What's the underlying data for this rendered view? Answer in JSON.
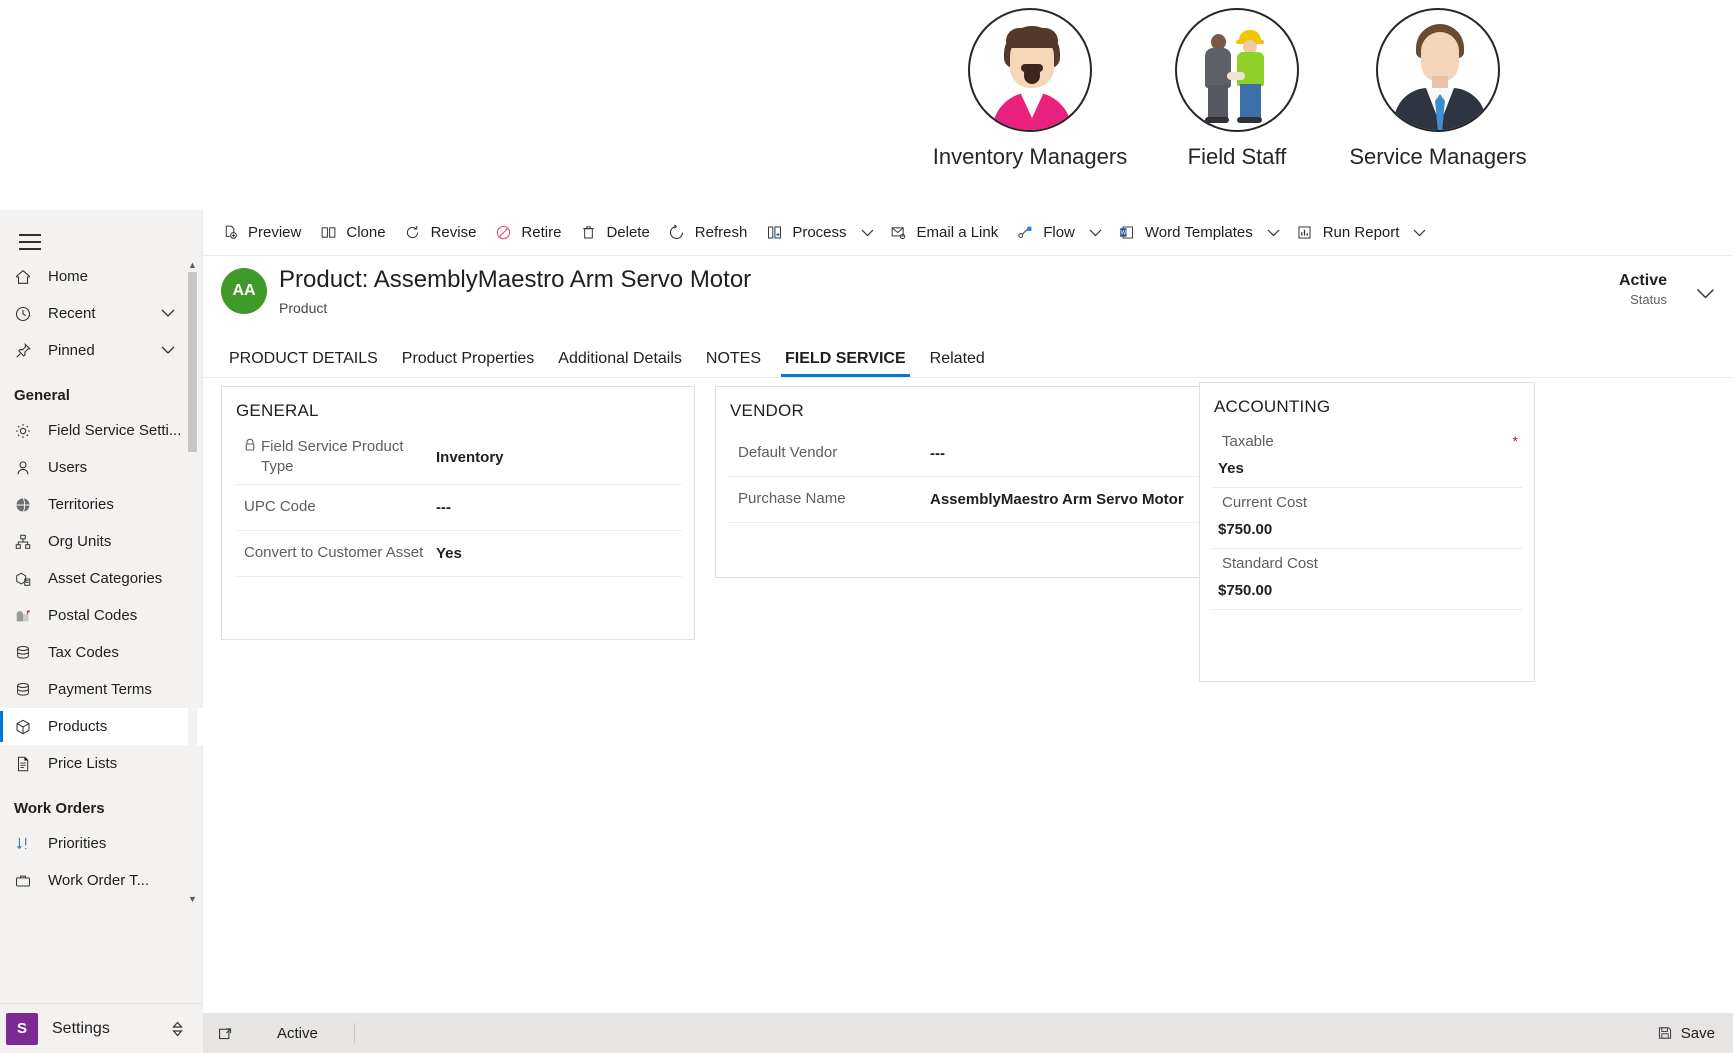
{
  "personas": [
    {
      "label": "Inventory Managers",
      "avatar": "inventory-manager-avatar"
    },
    {
      "label": "Field Staff",
      "avatar": "field-staff-avatar"
    },
    {
      "label": "Service Managers",
      "avatar": "service-manager-avatar"
    }
  ],
  "sidebar": {
    "top_items": [
      {
        "label": "Home",
        "icon": "home-icon",
        "chevron": false
      },
      {
        "label": "Recent",
        "icon": "clock-icon",
        "chevron": true
      },
      {
        "label": "Pinned",
        "icon": "pin-icon",
        "chevron": true
      }
    ],
    "groups": [
      {
        "title": "General",
        "items": [
          {
            "label": "Field Service Setti...",
            "icon": "gear-icon",
            "selected": false
          },
          {
            "label": "Users",
            "icon": "user-icon",
            "selected": false
          },
          {
            "label": "Territories",
            "icon": "globe-icon",
            "selected": false
          },
          {
            "label": "Org Units",
            "icon": "org-chart-icon",
            "selected": false
          },
          {
            "label": "Asset Categories",
            "icon": "asset-box-icon",
            "selected": false
          },
          {
            "label": "Postal Codes",
            "icon": "mailbox-icon",
            "selected": false
          },
          {
            "label": "Tax Codes",
            "icon": "database-icon",
            "selected": false
          },
          {
            "label": "Payment Terms",
            "icon": "database-icon",
            "selected": false
          },
          {
            "label": "Products",
            "icon": "package-icon",
            "selected": true
          },
          {
            "label": "Price Lists",
            "icon": "document-icon",
            "selected": false
          }
        ]
      },
      {
        "title": "Work Orders",
        "items": [
          {
            "label": "Priorities",
            "icon": "sort-arrows-icon",
            "selected": false
          },
          {
            "label": "Work Order T...",
            "icon": "briefcase-icon",
            "selected": false
          }
        ]
      }
    ],
    "settings": {
      "badge": "S",
      "label": "Settings",
      "caret": "expand-icon"
    }
  },
  "commandbar": {
    "items": [
      {
        "label": "Preview",
        "icon": "preview-icon",
        "caret": false
      },
      {
        "label": "Clone",
        "icon": "clone-icon",
        "caret": false
      },
      {
        "label": "Revise",
        "icon": "revise-icon",
        "caret": false
      },
      {
        "label": "Retire",
        "icon": "retire-icon",
        "caret": false
      },
      {
        "label": "Delete",
        "icon": "trash-icon",
        "caret": false
      },
      {
        "label": "Refresh",
        "icon": "refresh-icon",
        "caret": false
      },
      {
        "label": "Process",
        "icon": "process-icon",
        "caret": true
      },
      {
        "label": "Email a Link",
        "icon": "email-link-icon",
        "caret": false
      },
      {
        "label": "Flow",
        "icon": "flow-icon",
        "caret": true
      },
      {
        "label": "Word Templates",
        "icon": "word-icon",
        "caret": true
      },
      {
        "label": "Run Report",
        "icon": "report-icon",
        "caret": true
      }
    ]
  },
  "record": {
    "avatar_initials": "AA",
    "avatar_color": "#3f9a29",
    "title": "Product: AssemblyMaestro Arm Servo Motor",
    "subtitle": "Product",
    "status_value": "Active",
    "status_caption": "Status"
  },
  "tabs": [
    {
      "label": "PRODUCT DETAILS",
      "active": false
    },
    {
      "label": "Product Properties",
      "active": false
    },
    {
      "label": "Additional Details",
      "active": false
    },
    {
      "label": "NOTES",
      "active": false
    },
    {
      "label": "FIELD SERVICE",
      "active": true
    },
    {
      "label": "Related",
      "active": false
    }
  ],
  "cards": {
    "general": {
      "title": "GENERAL",
      "fields": [
        {
          "label": "Field Service Product Type",
          "value": "Inventory",
          "locked": true
        },
        {
          "label": "UPC Code",
          "value": "---",
          "locked": false
        },
        {
          "label": "Convert to Customer Asset",
          "value": "Yes",
          "locked": false
        }
      ]
    },
    "vendor": {
      "title": "VENDOR",
      "fields": [
        {
          "label": "Default Vendor",
          "value": "---"
        },
        {
          "label": "Purchase Name",
          "value": "AssemblyMaestro Arm Servo Motor"
        }
      ]
    },
    "accounting": {
      "title": "ACCOUNTING",
      "fields": [
        {
          "label": "Taxable",
          "value": "Yes",
          "required": true
        },
        {
          "label": "Current Cost",
          "value": "$750.00",
          "required": false
        },
        {
          "label": "Standard Cost",
          "value": "$750.00",
          "required": false
        }
      ]
    }
  },
  "footer": {
    "status": "Active",
    "save_label": "Save",
    "save_icon": "save-icon",
    "left_icon": "popout-icon"
  },
  "colors": {
    "accent": "#0078d4",
    "avatar_green": "#3f9a29",
    "settings_purple": "#7d2b94",
    "required_red": "#a4262c",
    "sidebar_bg": "#f3f2f1",
    "footer_bg": "#e6e5e4"
  }
}
